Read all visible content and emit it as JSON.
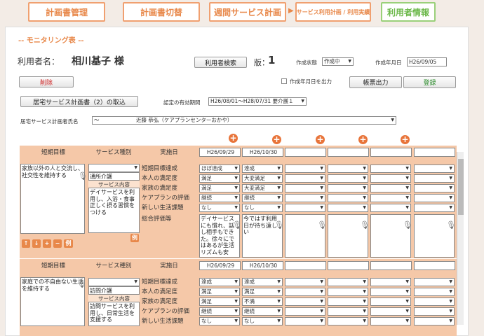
{
  "nav": {
    "plan_management": "計画書管理",
    "plan_switch": "計画書切替",
    "weekly_plan": "週間サービス計画",
    "service_usage": "サービス利用計画 / 利用実績",
    "user_info": "利用者情報"
  },
  "title": "-- モニタリング表 --",
  "user": {
    "label": "利用者名：",
    "name": "相川基子 様",
    "search_button": "利用者検索",
    "version_label": "版：",
    "version": "1",
    "status_label": "作成状態",
    "status_value": "作成中",
    "date_label": "作成年月日",
    "date_value": "H26/09/05"
  },
  "buttons": {
    "delete": "削除",
    "print_date_check": "作成年月日を出力",
    "form_output": "帳票出力",
    "register": "登録",
    "import_plan": "居宅サービス計画書（2）の取込"
  },
  "validity": {
    "label": "認定の有効期間",
    "value": "H26/08/01～H28/07/31 要介護１"
  },
  "planner": {
    "label": "居宅サービス計画者氏名",
    "value": "～　　　　　　　近藤 恭弘（ケアプランセンターおかや）"
  },
  "table": {
    "headers": {
      "short_goal": "短期目標",
      "service_type": "サービス種別",
      "impl_date": "実施日",
      "service_content": "サービス内容"
    },
    "row_labels": [
      "短期目標達成",
      "本人の満足度",
      "家族の満足度",
      "ケアプランの評価",
      "新しい生活課題",
      "総合評価等"
    ],
    "blocks": [
      {
        "goal_text": "家族以外の人と交流し、社交性を維持する",
        "service_type_value": "通所介護",
        "service_content_text": "デイサービスを利用し、入浴・食事正しく摂る習慣をつける",
        "example_label": "例",
        "dates": [
          "H26/09/29",
          "H26/10/30"
        ],
        "col1": [
          "ほぼ達成",
          "満足",
          "満足",
          "継続",
          "なし"
        ],
        "col2": [
          "達成",
          "大変満足",
          "大変満足",
          "継続",
          "なし"
        ],
        "comment1": "デイサービスにも慣れ、話し相手もできた。徐々にではあるが生活リズムも安",
        "comment2": "今ではす利用日が待ち遠しい"
      },
      {
        "goal_text": "家庭での不自由ない生活を維持する",
        "service_type_value": "訪問介護",
        "service_content_text": "訪問サービスを利用し、日常生活を支援する",
        "dates": [
          "H26/09/29",
          "H26/10/30"
        ],
        "col1": [
          "達成",
          "満足",
          "満足",
          "継続",
          "なし"
        ],
        "col2": [
          "達成",
          "満足",
          "不満",
          "継続",
          "なし"
        ]
      }
    ],
    "small_buttons": [
      "↑",
      "↓",
      "+",
      "−",
      "例"
    ]
  },
  "colors": {
    "accent": "#e8884a",
    "header_bg": "#f5c8a8",
    "plus": "#e8743a",
    "register_text": "#2a8a2a",
    "delete_text": "#cc2222"
  }
}
